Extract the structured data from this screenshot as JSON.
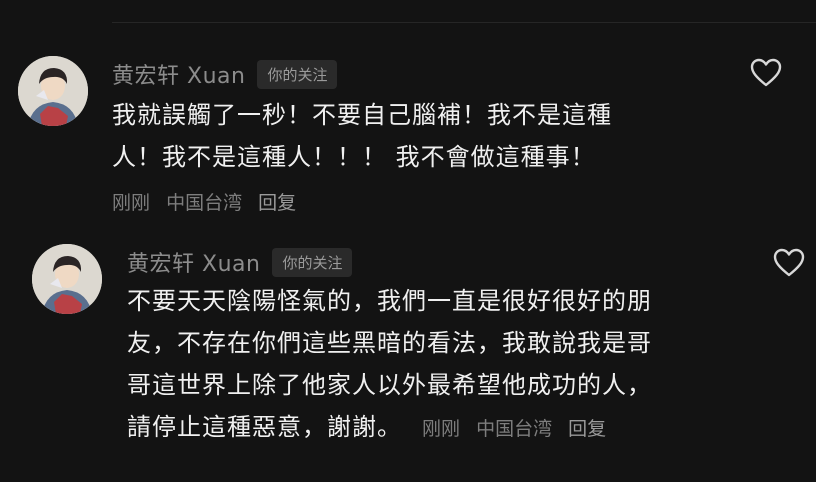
{
  "comments": [
    {
      "username": "黄宏轩 Xuan",
      "badge": "你的关注",
      "lines": [
        "我就誤觸了一秒！不要自己腦補！我不是這種",
        "人！我不是這種人！！！ 我不會做這種事！"
      ],
      "time": "刚刚",
      "location": "中国台湾",
      "reply": "回复",
      "like_icon": "heart-outline-icon"
    },
    {
      "username": "黄宏轩 Xuan",
      "badge": "你的关注",
      "lines": [
        "不要天天陰陽怪氣的，我們一直是很好很好的朋",
        "友，不存在你們這些黑暗的看法，我敢說我是哥",
        "哥這世界上除了他家人以外最希望他成功的人，",
        "請停止這種惡意，謝謝。"
      ],
      "time": "刚刚",
      "location": "中国台湾",
      "reply": "回复",
      "like_icon": "heart-outline-icon"
    }
  ],
  "colors": {
    "background": "#131313",
    "text": "#f0f0f0",
    "muted": "#8c8c8c",
    "badge_bg": "#2a2a2a"
  }
}
